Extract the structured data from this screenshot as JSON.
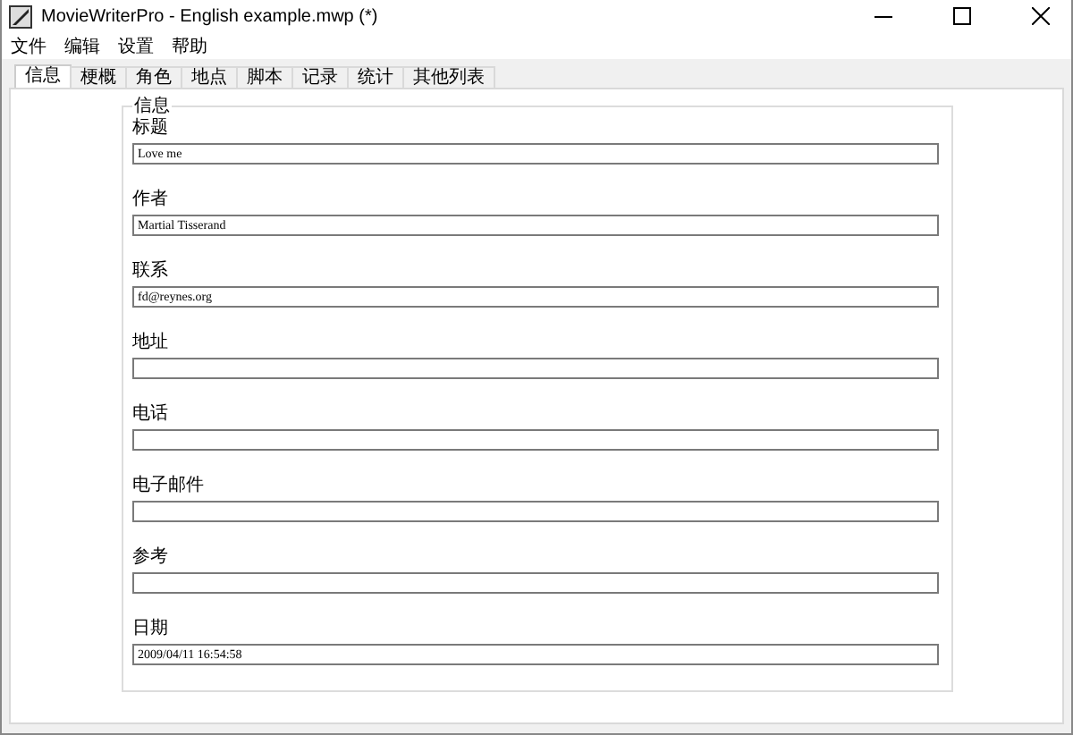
{
  "window": {
    "title": "MovieWriterPro - English example.mwp (*)"
  },
  "menu": [
    "文件",
    "编辑",
    "设置",
    "帮助"
  ],
  "tabs": [
    {
      "label": "信息",
      "selected": true
    },
    {
      "label": "梗概",
      "selected": false
    },
    {
      "label": "角色",
      "selected": false
    },
    {
      "label": "地点",
      "selected": false
    },
    {
      "label": "脚本",
      "selected": false
    },
    {
      "label": "记录",
      "selected": false
    },
    {
      "label": "统计",
      "selected": false
    },
    {
      "label": "其他列表",
      "selected": false
    }
  ],
  "group": {
    "title": "信息",
    "fields": [
      {
        "label": "标题",
        "value": "Love me"
      },
      {
        "label": "作者",
        "value": "Martial Tisserand"
      },
      {
        "label": "联系",
        "value": "fd@reynes.org"
      },
      {
        "label": "地址"
      },
      {
        "label": "电话"
      },
      {
        "label": "电子邮件"
      },
      {
        "label": "参考"
      },
      {
        "label": "日期",
        "value": "2009/04/11 16:54:58"
      }
    ]
  }
}
